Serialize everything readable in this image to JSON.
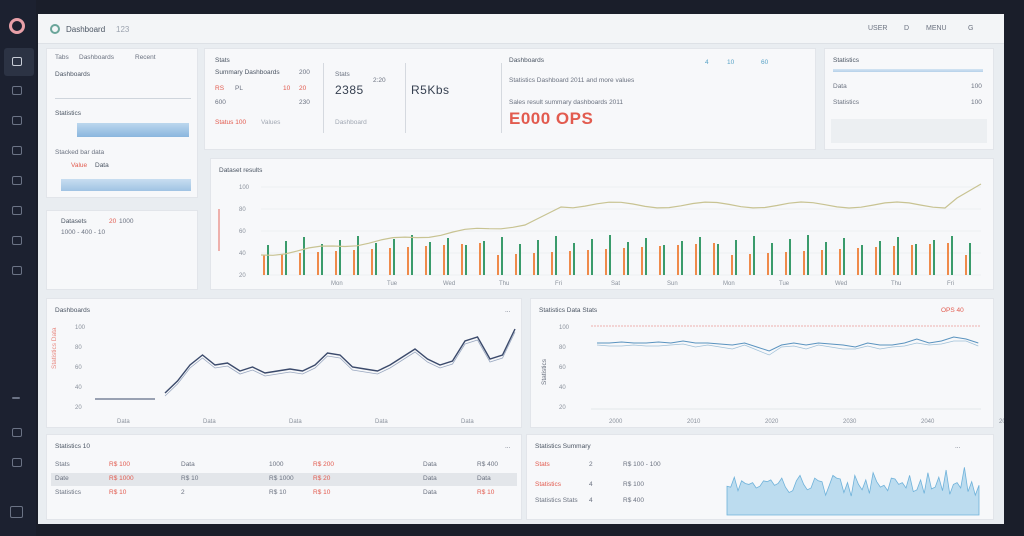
{
  "app": {
    "title": "Dashboard",
    "subtitle": "123"
  },
  "topbar": {
    "items": [
      "USER",
      "D",
      "MENU",
      "G"
    ]
  },
  "sidebar": {
    "icons": [
      "dashboard-icon",
      "list-icon",
      "inbox-icon",
      "document-icon",
      "calendar-icon",
      "wave-icon",
      "chart-icon",
      "grid-icon",
      "collapse-icon",
      "tools-icon",
      "settings-icon",
      "user-icon"
    ]
  },
  "filters": {
    "tab1": "Tabs",
    "tab2": "Dashboards",
    "tab3": "Recent",
    "label1": "Dashboards",
    "label2": "Statistics",
    "label3": "Stacked bar data",
    "tags": [
      "Value",
      "Data"
    ]
  },
  "legend_card": {
    "title": "Datasets",
    "v1": "20",
    "v2": "1000",
    "row": "1000 - 400 - 10"
  },
  "kpi": {
    "title": "Stats",
    "subtitle": "Summary Dashboards",
    "col_labels": [
      "200",
      "600",
      "230"
    ],
    "rows_left": [
      "RS",
      "PL",
      "10",
      "20"
    ],
    "m1_label": "Stats",
    "m1_sub": "2:20",
    "m1_value": "2385",
    "m2_value": "R5Kbs",
    "foot_left": "Status 100",
    "foot_mid": "Values",
    "foot_right": "Dashboard",
    "right_title": "Dashboards",
    "right_row": "Statistics Dashboard 2011 and more values",
    "right_sub": "Sales result summary dashboards 2011",
    "big_value": "E000 OPS",
    "small_icons": [
      "4",
      "10",
      "60"
    ]
  },
  "summary": {
    "title": "Statistics",
    "rows": [
      "Data",
      "100",
      "Statistics",
      "100"
    ]
  },
  "main_chart": {
    "title": "Dataset results",
    "yticks": [
      "100",
      "80",
      "60",
      "40",
      "20"
    ],
    "xticks": [
      "Mon",
      "Tue",
      "Wed",
      "Thu",
      "Fri",
      "Sat",
      "Sun",
      "Mon",
      "Tue",
      "Wed",
      "Thu",
      "Fri"
    ]
  },
  "chart2": {
    "title": "Dashboards",
    "ylabel": "Statistics Data",
    "yticks": [
      "100",
      "80",
      "60",
      "40",
      "20"
    ],
    "xticks": [
      "Data",
      "Data",
      "Data",
      "Data",
      "Data"
    ],
    "menu": "..."
  },
  "chart3": {
    "title": "Statistics Data Stats",
    "tag": "OPS 40",
    "ylabel": "Statistics",
    "yticks": [
      "100",
      "80",
      "60",
      "40",
      "20"
    ],
    "xticks": [
      "2000",
      "2010",
      "2020",
      "2030",
      "2040",
      "2050"
    ]
  },
  "table": {
    "title": "Statistics 10",
    "menu": "...",
    "rows": [
      [
        "Stats",
        "R$ 100",
        "Data",
        "1000",
        "R$ 200",
        "Data",
        "R$ 400"
      ],
      [
        "Date",
        "R$ 1000",
        "R$ 10",
        "R$ 1000",
        "R$ 20",
        "Data",
        "Data",
        "Data"
      ],
      [
        "Statistics",
        "R$ 10",
        "2",
        "R$ 10",
        "R$ 10",
        "Data",
        "R$ 10",
        "R$ 10"
      ]
    ]
  },
  "spark": {
    "title": "Statistics Summary",
    "menu": "...",
    "rows": [
      [
        "Stats",
        "2",
        "R$ 100 - 100"
      ],
      [
        "Statistics",
        "4",
        "R$ 100"
      ],
      [
        "Statistics Stats",
        "4",
        "R$ 400"
      ]
    ]
  },
  "colors": {
    "red": "#e25b4f",
    "green": "#3a9b6b",
    "orange": "#ef8a4a",
    "blue": "#8ab6de",
    "olive": "#c8c392",
    "navy": "#3b4a6b"
  }
}
